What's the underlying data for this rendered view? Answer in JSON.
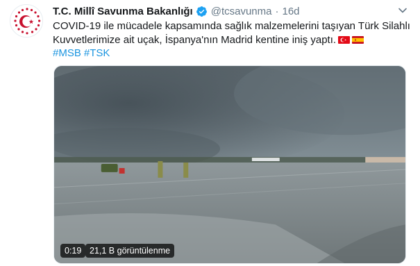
{
  "tweet": {
    "display_name": "T.C. Millî Savunma Bakanlığı",
    "handle": "@tcsavunma",
    "separator": "·",
    "time": "16d",
    "text_line1": "COVID-19 ile mücadele kapsamında sağlık malzemelerini taşıyan Türk Silahlı",
    "text_line2": "Kuvvetlerimize ait uçak, İspanya'nın Madrid kentine iniş yaptı.",
    "hashtags": [
      "#MSB",
      "#TSK"
    ],
    "flags": [
      "turkey-flag",
      "spain-flag"
    ]
  },
  "video": {
    "duration": "0:19",
    "views": "21,1 B görüntülenme"
  },
  "colors": {
    "link": "#1b95e0",
    "verified": "#1da1f2",
    "turkey_red": "#e30a17",
    "spain_red": "#c60b1e",
    "spain_yellow": "#ffc400",
    "avatar_red": "#c8102e"
  }
}
